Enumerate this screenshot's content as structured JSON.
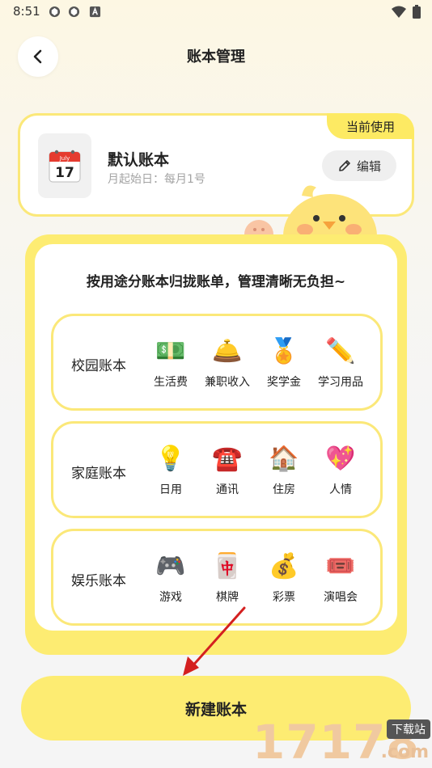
{
  "status_bar": {
    "time": "8:51",
    "icons": [
      "app-icon",
      "app-icon",
      "a-icon",
      "wifi-icon",
      "battery-icon"
    ]
  },
  "header": {
    "title": "账本管理",
    "back_icon": "chevron-left-icon"
  },
  "current_book": {
    "badge": "当前使用",
    "icon": "calendar-icon",
    "calendar_month": "July",
    "calendar_day": "17",
    "name": "默认账本",
    "subtitle": "月起始日：每月1号",
    "edit_label": "编辑",
    "edit_icon": "pencil-icon"
  },
  "panel": {
    "heading": "按用途分账本归拢账单，管理清晰无负担~",
    "groups": [
      {
        "name": "校园账本",
        "categories": [
          {
            "emoji": "💵",
            "label": "生活费",
            "icon": "money-icon"
          },
          {
            "emoji": "🛎️",
            "label": "兼职收入",
            "icon": "bell-icon"
          },
          {
            "emoji": "🏅",
            "label": "奖学金",
            "icon": "medal-icon"
          },
          {
            "emoji": "✏️",
            "label": "学习用品",
            "icon": "pencil-icon"
          }
        ]
      },
      {
        "name": "家庭账本",
        "categories": [
          {
            "emoji": "💡",
            "label": "日用",
            "icon": "bulb-icon"
          },
          {
            "emoji": "☎️",
            "label": "通讯",
            "icon": "telephone-icon"
          },
          {
            "emoji": "🏠",
            "label": "住房",
            "icon": "house-icon"
          },
          {
            "emoji": "💖",
            "label": "人情",
            "icon": "heart-icon"
          }
        ]
      },
      {
        "name": "娱乐账本",
        "categories": [
          {
            "emoji": "🎮",
            "label": "游戏",
            "icon": "gamepad-icon"
          },
          {
            "emoji": "🀄",
            "label": "棋牌",
            "icon": "mahjong-icon"
          },
          {
            "emoji": "💰",
            "label": "彩票",
            "icon": "money-bag-icon"
          },
          {
            "emoji": "🎟️",
            "label": "演唱会",
            "icon": "ticket-icon"
          }
        ]
      }
    ]
  },
  "create_button": {
    "label": "新建账本"
  },
  "watermark": {
    "number": "17178",
    "tag": "下载站",
    "domain": ".com"
  },
  "colors": {
    "accent_yellow": "#fdec72",
    "border_yellow": "#fbe879",
    "arrow_red": "#d42020"
  }
}
